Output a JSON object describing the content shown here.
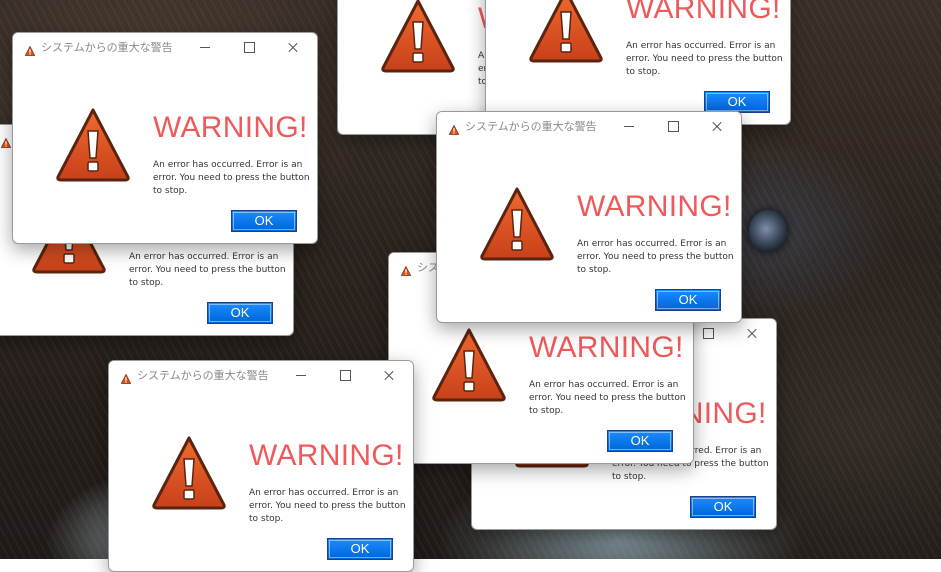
{
  "dialog": {
    "title": "システムからの重大な警告",
    "headline": "WARNING!",
    "message": "An error has occurred. Error is an error. You need to press the button to stop.",
    "ok_label": "OK",
    "icon": "warning-triangle-icon"
  },
  "colors": {
    "headline": "#ee5a5c",
    "ok_button": "#0a78f0",
    "warning_icon": "#e0531f"
  }
}
